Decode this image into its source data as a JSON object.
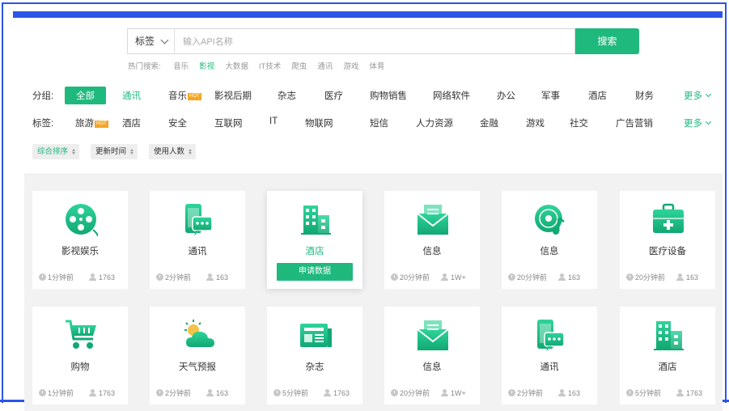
{
  "search": {
    "select_label": "标签",
    "placeholder": "输入API名称",
    "button_label": "搜索",
    "hot_label": "热门搜索:",
    "hot_terms": [
      "音乐",
      "影视",
      "大数据",
      "IT技术",
      "爬虫",
      "通讯",
      "游戏",
      "体育"
    ]
  },
  "groups": {
    "label": "分组:",
    "items": [
      "全部",
      "通讯",
      "音乐",
      "影视后期",
      "杂志",
      "医疗",
      "购物销售",
      "网络软件",
      "办公",
      "军事",
      "酒店",
      "财务"
    ],
    "hot_badge": "HOT",
    "more": "更多"
  },
  "tags": {
    "label": "标签:",
    "items": [
      "旅游",
      "酒店",
      "安全",
      "互联网",
      "IT",
      "物联网",
      "短信",
      "人力资源",
      "金融",
      "游戏",
      "社交",
      "广告营销"
    ],
    "hot_badge": "HOT",
    "more": "更多"
  },
  "sort": [
    "综合排序",
    "更新时间",
    "使用人数"
  ],
  "cards": [
    {
      "name": "影视娱乐",
      "time": "1分钟前",
      "users": "1763",
      "icon": "film-reel-icon"
    },
    {
      "name": "通讯",
      "time": "2分钟前",
      "users": "163",
      "icon": "phone-chat-icon"
    },
    {
      "name": "酒店",
      "time": "",
      "users": "",
      "icon": "hotel-building-icon",
      "button": "申请数据"
    },
    {
      "name": "信息",
      "time": "20分钟前",
      "users": "1W+",
      "icon": "mail-envelope-icon"
    },
    {
      "name": "信息",
      "time": "20分钟前",
      "users": "163",
      "icon": "music-disc-icon"
    },
    {
      "name": "医疗设备",
      "time": "20分钟前",
      "users": "163",
      "icon": "medical-kit-icon"
    },
    {
      "name": "购物",
      "time": "1分钟前",
      "users": "1763",
      "icon": "shopping-cart-icon"
    },
    {
      "name": "天气预报",
      "time": "2分钟前",
      "users": "163",
      "icon": "weather-cloud-icon"
    },
    {
      "name": "杂志",
      "time": "5分钟前",
      "users": "1763",
      "icon": "newspaper-icon"
    },
    {
      "name": "信息",
      "time": "20分钟前",
      "users": "1W+",
      "icon": "mail-envelope-icon"
    },
    {
      "name": "通讯",
      "time": "2分钟前",
      "users": "163",
      "icon": "phone-chat-icon"
    },
    {
      "name": "酒店",
      "time": "5分钟前",
      "users": "1763",
      "icon": "hotel-building-icon"
    }
  ],
  "colors": {
    "accent": "#1fb97e",
    "frame": "#2b55e8",
    "hot_badge": "#f5a623"
  }
}
